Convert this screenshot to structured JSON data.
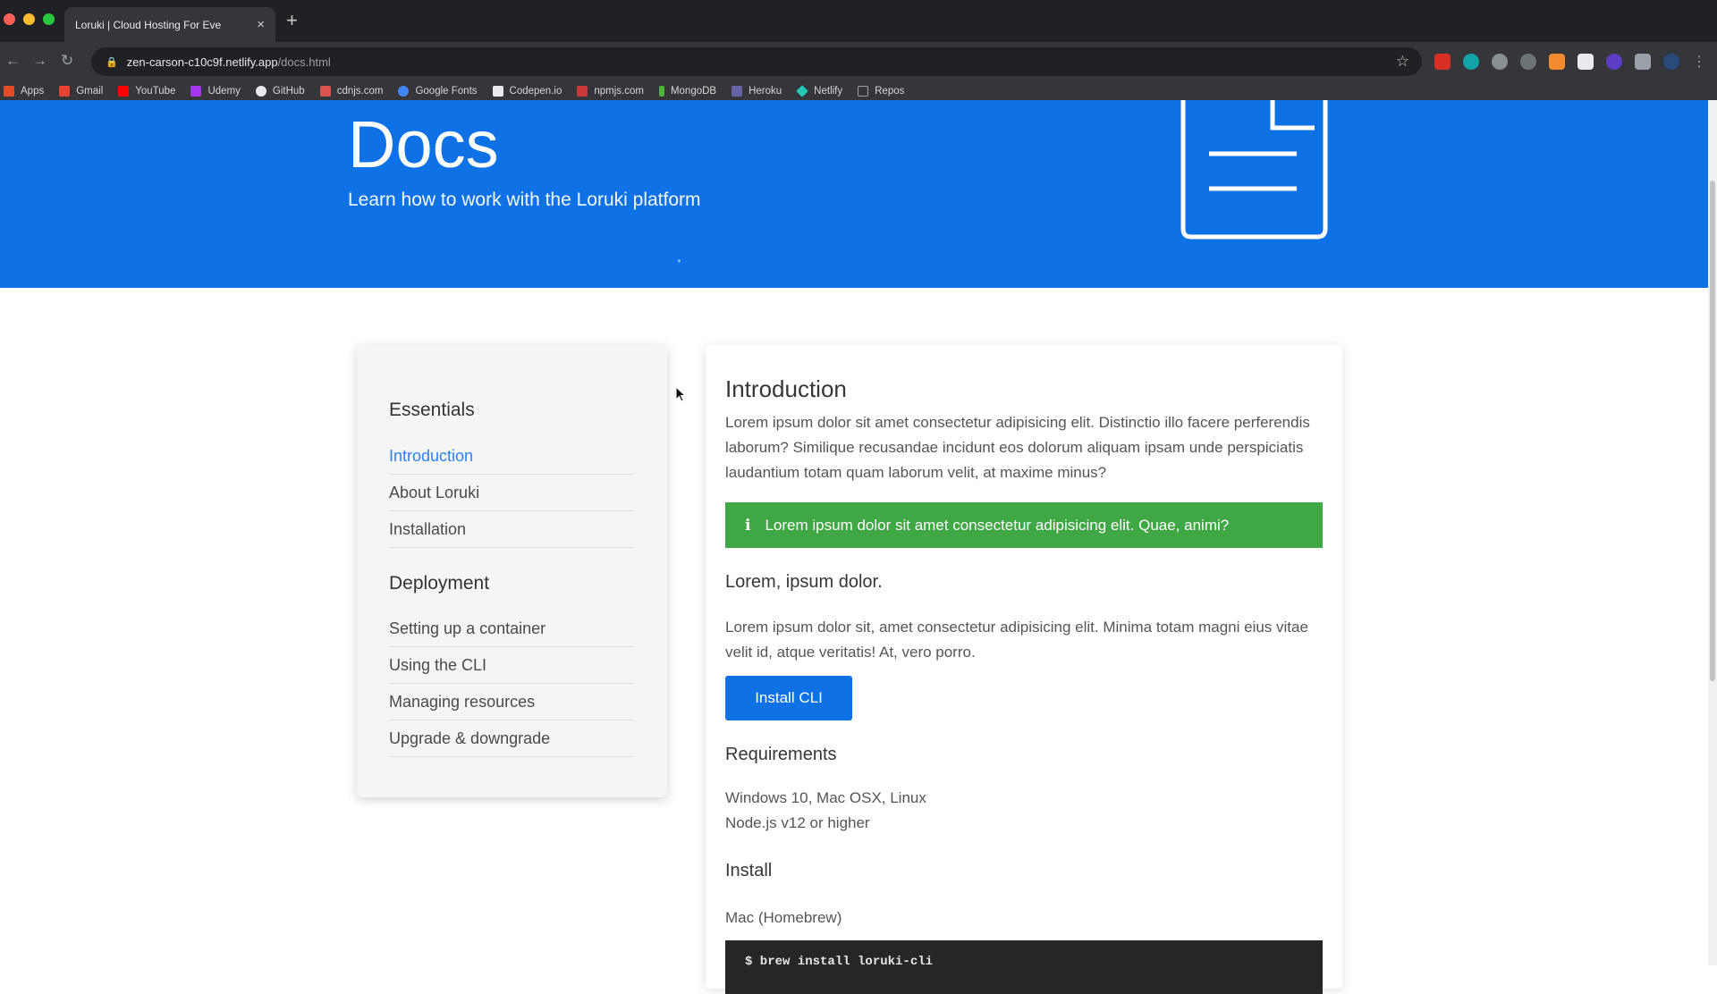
{
  "browser": {
    "tab_title": "Loruki | Cloud Hosting For Eve",
    "tab_close": "×",
    "new_tab": "+",
    "url_host": "zen-carson-c10c9f.netlify.app",
    "url_path": "/docs.html",
    "bookmarks": [
      {
        "label": "Apps",
        "color": "#e34c26"
      },
      {
        "label": "Gmail",
        "color": "#ea4335"
      },
      {
        "label": "YouTube",
        "color": "#ff0000"
      },
      {
        "label": "Udemy",
        "color": "#a435f0"
      },
      {
        "label": "GitHub",
        "color": "#e8eaed"
      },
      {
        "label": "cdnjs.com",
        "color": "#d9534f"
      },
      {
        "label": "Google Fonts",
        "color": "#4285f4"
      },
      {
        "label": "Codepen.io",
        "color": "#e8eaed"
      },
      {
        "label": "npmjs.com",
        "color": "#cb3837"
      },
      {
        "label": "MongoDB",
        "color": "#4db33d"
      },
      {
        "label": "Heroku",
        "color": "#6762a6"
      },
      {
        "label": "Netlify",
        "color": "#25c7b7"
      },
      {
        "label": "Repos",
        "color": "#9aa0a6"
      }
    ]
  },
  "hero": {
    "title": "Docs",
    "subtitle": "Learn how to work with the Loruki platform",
    "icon": "document-icon",
    "background": "#0e72e6"
  },
  "sidebar": {
    "sections": [
      {
        "heading": "Essentials",
        "items": [
          {
            "label": "Introduction",
            "active": true
          },
          {
            "label": "About Loruki"
          },
          {
            "label": "Installation"
          }
        ]
      },
      {
        "heading": "Deployment",
        "items": [
          {
            "label": "Setting up a container"
          },
          {
            "label": "Using the CLI"
          },
          {
            "label": "Managing resources"
          },
          {
            "label": "Upgrade & downgrade"
          }
        ]
      }
    ]
  },
  "main": {
    "title": "Introduction",
    "intro": "Lorem ipsum dolor sit amet consectetur adipisicing elit. Distinctio illo facere perferendis laborum? Similique recusandae incidunt eos dolorum aliquam ipsam unde perspiciatis laudantium totam quam laborum velit, at maxime minus?",
    "notice": {
      "icon": "info-icon",
      "text": "Lorem ipsum dolor sit amet consectetur adipisicing elit. Quae, animi?",
      "color": "#3fa743"
    },
    "section_title": "Lorem, ipsum dolor.",
    "section_text": "Lorem ipsum dolor sit, amet consectetur adipisicing elit. Minima totam magni eius vitae velit id, atque veritatis! At, vero porro.",
    "button": "Install CLI",
    "requirements_title": "Requirements",
    "requirements": [
      "Windows 10, Mac OSX, Linux",
      "Node.js v12 or higher"
    ],
    "install_title": "Install",
    "mac_label": "Mac (Homebrew)",
    "code": "$ brew install loruki-cli"
  }
}
